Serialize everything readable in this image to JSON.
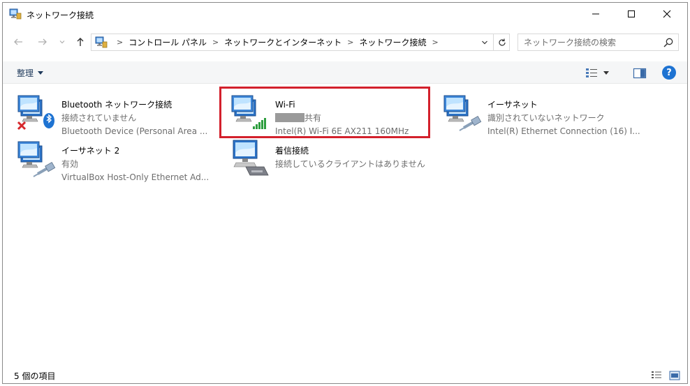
{
  "window": {
    "title": "ネットワーク接続"
  },
  "address": {
    "crumbs": [
      "コントロール パネル",
      "ネットワークとインターネット",
      "ネットワーク接続"
    ]
  },
  "search": {
    "placeholder": "ネットワーク接続の検索"
  },
  "toolbar": {
    "organize_label": "整理"
  },
  "connections": [
    {
      "name": "Bluetooth ネットワーク接続",
      "status": "接続されていません",
      "device": "Bluetooth Device (Personal Area ..."
    },
    {
      "name": "Wi-Fi",
      "status": "共有",
      "device": "Intel(R) Wi-Fi 6E AX211 160MHz"
    },
    {
      "name": "イーサネット",
      "status": "識別されていないネットワーク",
      "device": "Intel(R) Ethernet Connection (16) I..."
    },
    {
      "name": "イーサネット 2",
      "status": "有効",
      "device": "VirtualBox Host-Only Ethernet Ad..."
    },
    {
      "name": "着信接続",
      "status": "接続しているクライアントはありません",
      "device": ""
    }
  ],
  "status_bar": {
    "text": "5 個の項目"
  },
  "colors": {
    "highlight": "#d3202c",
    "help": "#1e73d2",
    "wifi_bars": "#2e9e3f"
  }
}
